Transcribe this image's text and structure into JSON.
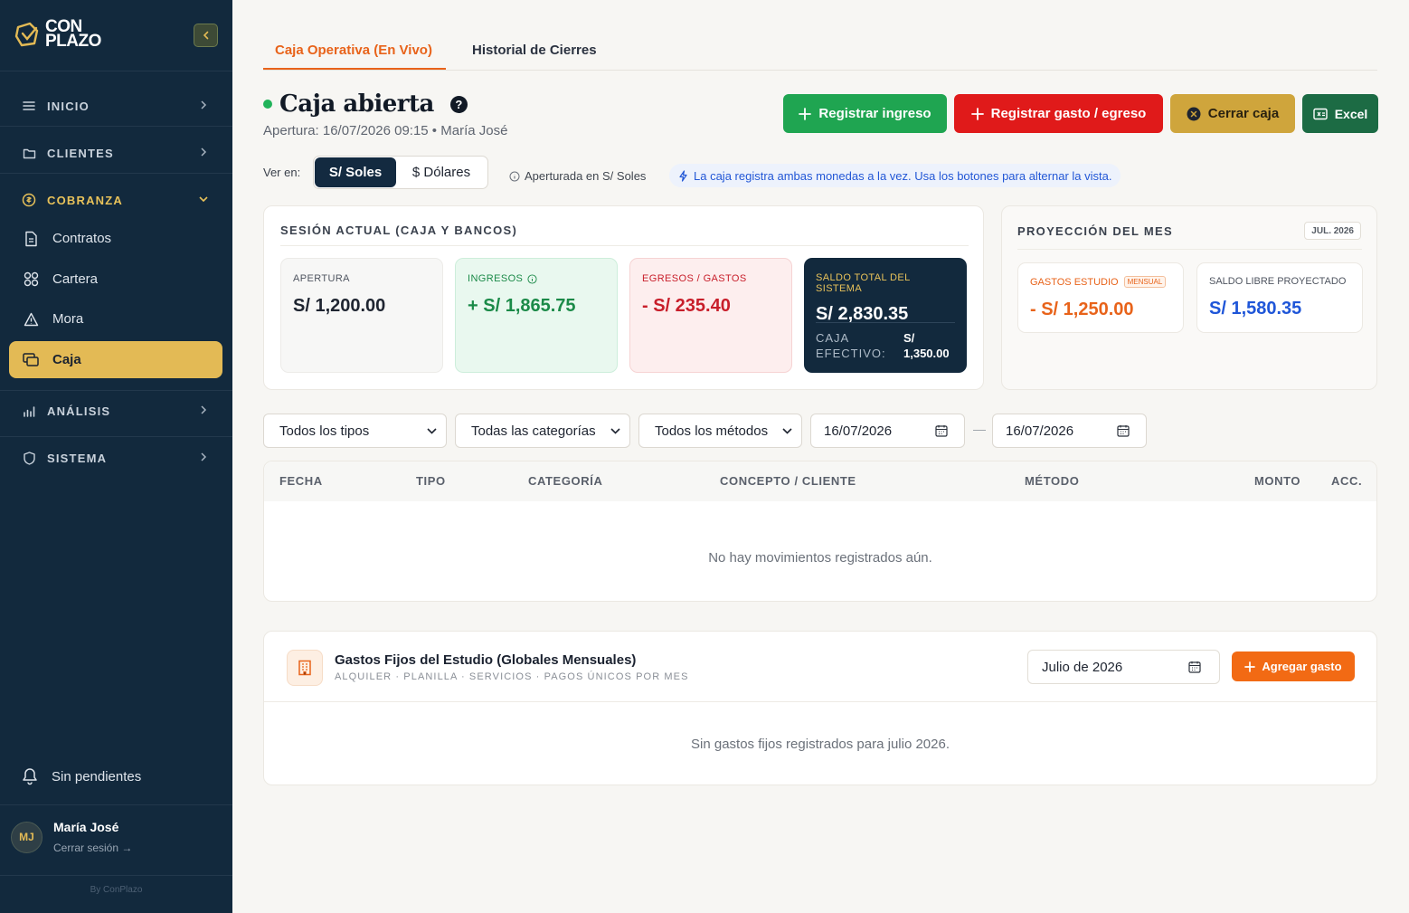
{
  "sidebar": {
    "logo_line1": "CON",
    "logo_line2": "PLAZO",
    "sections": {
      "inicio": "INICIO",
      "clientes": "CLIENTES",
      "cobranza": "COBRANZA",
      "analisis": "ANÁLISIS",
      "sistema": "SISTEMA"
    },
    "items": {
      "contratos": "Contratos",
      "cartera": "Cartera",
      "mora": "Mora",
      "caja": "Caja"
    },
    "pending": "Sin pendientes",
    "user": {
      "initials": "MJ",
      "name": "María José",
      "logout": "Cerrar sesión →"
    },
    "byline": "By ConPlazo"
  },
  "tabs": {
    "live": "Caja Operativa (En Vivo)",
    "history": "Historial de Cierres"
  },
  "header": {
    "title": "Caja abierta",
    "help": "?",
    "opening": "Apertura: 16/07/2026 09:15 • María José"
  },
  "actions": {
    "income": "Registrar ingreso",
    "expense": "Registrar gasto / egreso",
    "close": "Cerrar caja",
    "excel": "Excel"
  },
  "view": {
    "label": "Ver en:",
    "soles": "S/ Soles",
    "dollars": "$ Dólares",
    "opened_in": "Aperturada en S/ Soles",
    "info": "La caja registra ambas monedas a la vez. Usa los botones para alternar la vista."
  },
  "session": {
    "title": "SESIÓN ACTUAL (CAJA Y BANCOS)",
    "apertura_label": "APERTURA",
    "apertura_value": "S/ 1,200.00",
    "ingresos_label": "INGRESOS",
    "ingresos_value": "+ S/ 1,865.75",
    "egresos_label": "EGRESOS / GASTOS",
    "egresos_value": "- S/ 235.40",
    "saldo_label": "SALDO TOTAL DEL SISTEMA",
    "saldo_value": "S/ 2,830.35",
    "efectivo_label_1": "CAJA",
    "efectivo_label_2": "EFECTIVO:",
    "efectivo_value_1": "S/",
    "efectivo_value_2": "1,350.00"
  },
  "projection": {
    "title": "PROYECCIÓN DEL MES",
    "month_badge": "JUL. 2026",
    "gastos_label": "GASTOS ESTUDIO",
    "gastos_badge": "MENSUAL",
    "gastos_value": "- S/ 1,250.00",
    "libre_label": "SALDO LIBRE PROYECTADO",
    "libre_value": "S/ 1,580.35"
  },
  "filters": {
    "tipo": "Todos los tipos",
    "categoria": "Todas las categorías",
    "metodo": "Todos los métodos",
    "date_from": "16/07/2026",
    "date_sep": "—",
    "date_to": "16/07/2026"
  },
  "table": {
    "headers": [
      "FECHA",
      "TIPO",
      "CATEGORÍA",
      "CONCEPTO / CLIENTE",
      "MÉTODO",
      "MONTO",
      "ACC."
    ],
    "empty": "No hay movimientos registrados aún."
  },
  "fixed": {
    "title": "Gastos Fijos del Estudio (Globales Mensuales)",
    "subtitle": "ALQUILER · PLANILLA · SERVICIOS · PAGOS ÚNICOS POR MES",
    "month": "Julio de 2026",
    "add": "Agregar gasto",
    "empty": "Sin gastos fijos registrados para julio 2026."
  },
  "colors": {
    "sidebar_bg": "#12293d",
    "accent_gold": "#e3ba55",
    "accent_orange": "#e8631a",
    "success": "#1fa551",
    "danger": "#e01a1a",
    "info_blue": "#2257d6"
  }
}
